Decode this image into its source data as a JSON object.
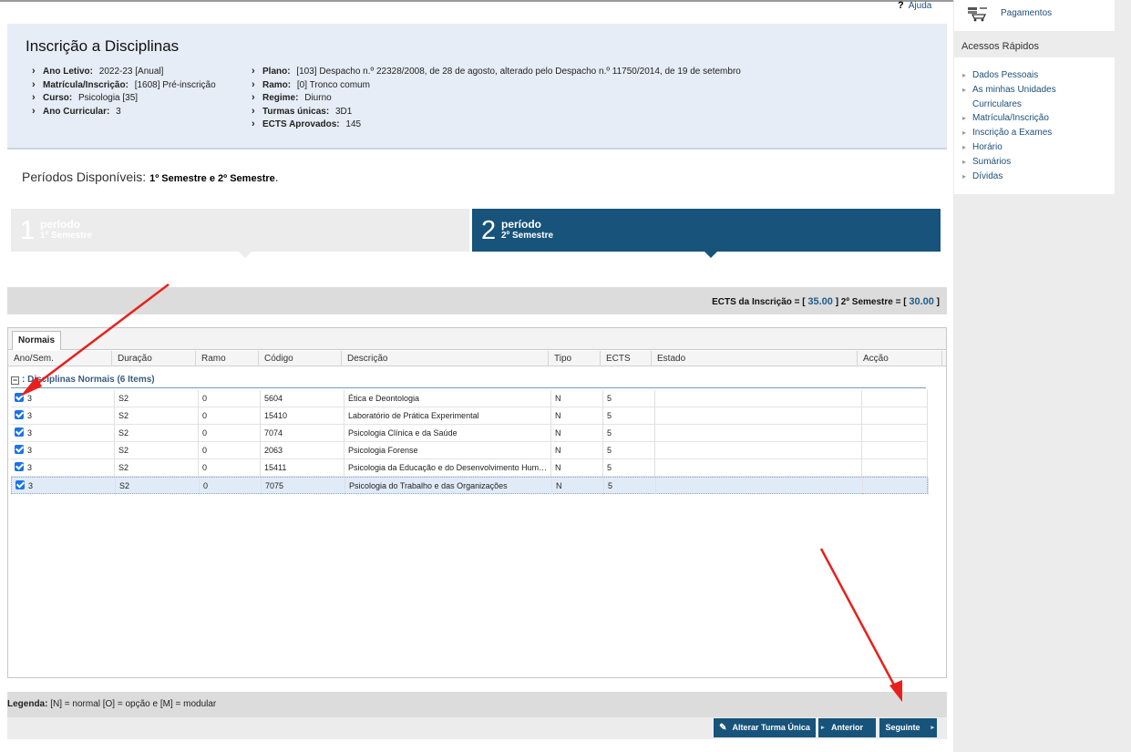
{
  "help": {
    "icon_text": "?",
    "label": "Ajuda"
  },
  "header": {
    "title": "Inscrição a Disciplinas",
    "left": [
      {
        "label": "Ano Letivo:",
        "value": "2022-23 [Anual]"
      },
      {
        "label": "Matrícula/Inscrição:",
        "value": "[1608] Pré-inscrição"
      },
      {
        "label": "Curso:",
        "value": "Psicologia [35]"
      },
      {
        "label": "Ano Curricular:",
        "value": "3"
      }
    ],
    "right": [
      {
        "label": "Plano:",
        "value": "[103] Despacho n.º 22328/2008, de 28 de agosto, alterado pelo Despacho n.º 11750/2014, de 19 de setembro"
      },
      {
        "label": "Ramo:",
        "value": "[0] Tronco comum"
      },
      {
        "label": "Regime:",
        "value": "Diurno"
      },
      {
        "label": "Turmas únicas:",
        "value": "3D1"
      },
      {
        "label": "ECTS Aprovados:",
        "value": "145"
      }
    ]
  },
  "periods": {
    "label": "Períodos Disponíveis:",
    "value": "1º Semestre e 2º Semestre",
    "suffix": ".",
    "tabs": [
      {
        "num": "1",
        "title": "período",
        "sub": "1º Semestre"
      },
      {
        "num": "2",
        "title": "período",
        "sub": "2º Semestre"
      }
    ]
  },
  "ects": {
    "prefix": "ECTS da Inscrição = [",
    "total": "35.00",
    "mid": "] 2º Semestre = [",
    "semester": "30.00",
    "suffix": "]"
  },
  "grid": {
    "tab": "Normais",
    "columns": [
      "Ano/Sem.",
      "Duração",
      "Ramo",
      "Código",
      "Descrição",
      "Tipo",
      "ECTS",
      "Estado",
      "Acção"
    ],
    "group_label": ": Disciplinas Normais (6 Items)",
    "group_toggle": "−",
    "rows": [
      {
        "ano": "3",
        "dur": "S2",
        "ramo": "0",
        "codigo": "5604",
        "descricao": "Ética e Deontologia",
        "tipo": "N",
        "ects": "5",
        "selected": false
      },
      {
        "ano": "3",
        "dur": "S2",
        "ramo": "0",
        "codigo": "15410",
        "descricao": "Laboratório de Prática Experimental",
        "tipo": "N",
        "ects": "5",
        "selected": false
      },
      {
        "ano": "3",
        "dur": "S2",
        "ramo": "0",
        "codigo": "7074",
        "descricao": "Psicologia Clínica e da Saúde",
        "tipo": "N",
        "ects": "5",
        "selected": false
      },
      {
        "ano": "3",
        "dur": "S2",
        "ramo": "0",
        "codigo": "2063",
        "descricao": "Psicologia Forense",
        "tipo": "N",
        "ects": "5",
        "selected": false
      },
      {
        "ano": "3",
        "dur": "S2",
        "ramo": "0",
        "codigo": "15411",
        "descricao": "Psicologia da Educação e do Desenvolvimento Humano",
        "tipo": "N",
        "ects": "5",
        "selected": false
      },
      {
        "ano": "3",
        "dur": "S2",
        "ramo": "0",
        "codigo": "7075",
        "descricao": "Psicologia do Trabalho e das Organizações",
        "tipo": "N",
        "ects": "5",
        "selected": true
      }
    ]
  },
  "legend": {
    "label": "Legenda:",
    "text": "[N] = normal [O] = opção e [M] = modular"
  },
  "buttons": {
    "alterar": "Alterar Turma Única",
    "anterior": "Anterior",
    "seguinte": "Seguinte"
  },
  "sidebar": {
    "pagamentos": "Pagamentos",
    "quick_title": "Acessos Rápidos",
    "items": [
      "Dados Pessoais",
      "As minhas Unidades Curriculares",
      "Matrícula/Inscrição",
      "Inscrição a Exames",
      "Horário",
      "Sumários",
      "Dívidas"
    ]
  },
  "colors": {
    "primary": "#17537a",
    "header_bg": "#e6edf6",
    "annotation_arrow": "#e8201c",
    "checkbox": "#1a73e8"
  }
}
